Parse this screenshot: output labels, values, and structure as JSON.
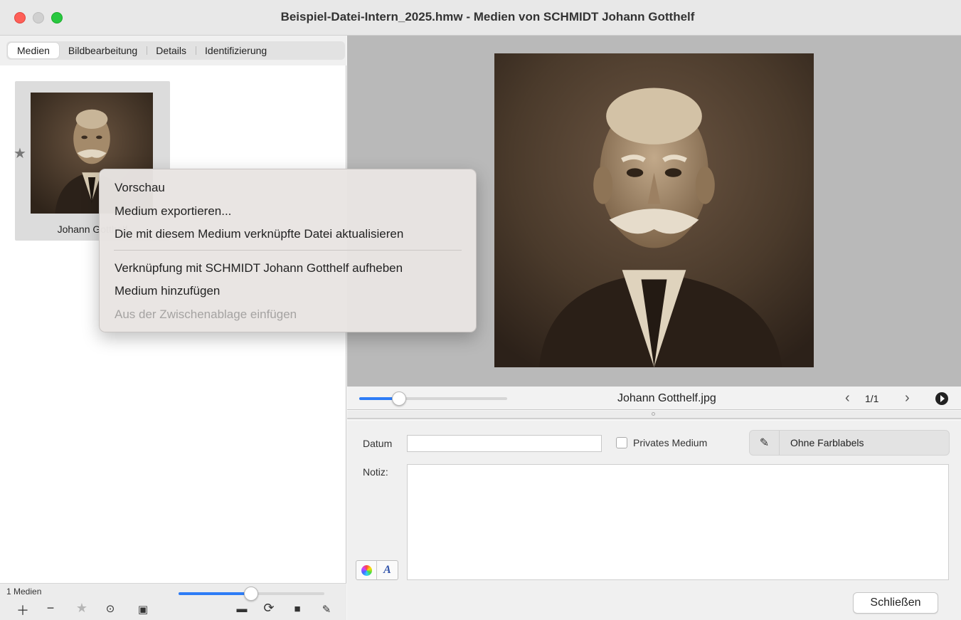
{
  "window": {
    "title": "Beispiel-Datei-Intern_2025.hmw - Medien von SCHMIDT Johann Gotthelf"
  },
  "left_panel": {
    "tabs": [
      {
        "label": "Medien",
        "active": true
      },
      {
        "label": "Bildbearbeitung",
        "active": false
      },
      {
        "label": "Details",
        "active": false
      },
      {
        "label": "Identifizierung",
        "active": false
      }
    ],
    "thumbnail_label": "Johann Gotthelf",
    "media_count": "1 Medien",
    "size_slider_value": 0.5,
    "toolbar_icons": [
      "plus-icon",
      "minus-icon",
      "star-icon",
      "more-icon",
      "gallery-icon",
      "folder-icon",
      "refresh-icon",
      "save-icon",
      "edit-icon"
    ]
  },
  "context_menu": {
    "items": [
      {
        "label": "Vorschau",
        "enabled": true
      },
      {
        "label": "Medium exportieren...",
        "enabled": true
      },
      {
        "label": "Die mit diesem Medium verknüpfte Datei aktualisieren",
        "enabled": true
      },
      {
        "label": "Verknüpfung mit SCHMIDT Johann Gotthelf aufheben",
        "enabled": true
      },
      {
        "label": "Medium hinzufügen",
        "enabled": true
      },
      {
        "label": "Aus der Zwischenablage einfügen",
        "enabled": false
      }
    ]
  },
  "viewer": {
    "filename": "Johann Gotthelf.jpg",
    "page_counter": "1/1",
    "zoom_slider_value": 0.25
  },
  "form": {
    "date_label": "Datum",
    "date_value": "",
    "private_label": "Privates Medium",
    "private_checked": false,
    "color_label_text": "Ohne Farblabels",
    "note_label": "Notiz:",
    "note_value": "",
    "close_label": "Schließen"
  },
  "colors": {
    "accent": "#2d7cf6",
    "traffic_red": "#fe5f57",
    "traffic_green": "#28c840"
  }
}
